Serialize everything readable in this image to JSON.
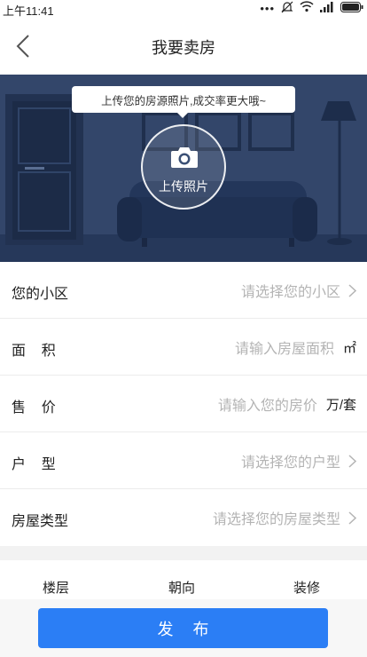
{
  "status_bar": {
    "time": "上午11:41",
    "icons": [
      "dots-icon",
      "mute-bell-icon",
      "wifi-icon",
      "signal-icon",
      "battery-icon"
    ]
  },
  "nav": {
    "title": "我要卖房",
    "back_icon": "chevron-left-icon"
  },
  "hero": {
    "tooltip": "上传您的房源照片,成交率更大哦~",
    "upload_label": "上传照片",
    "upload_icon": "camera-icon"
  },
  "form": {
    "community": {
      "label": "您的小区",
      "placeholder": "请选择您的小区"
    },
    "area": {
      "label": "面    积",
      "placeholder": "请输入房屋面积",
      "unit": "㎡"
    },
    "price": {
      "label": "售    价",
      "placeholder": "请输入您的房价",
      "unit": "万/套"
    },
    "layout": {
      "label": "户    型",
      "placeholder": "请选择您的户型"
    },
    "house_type": {
      "label": "房屋类型",
      "placeholder": "请选择您的房屋类型"
    }
  },
  "tabs": {
    "floor": "楼层",
    "orientation": "朝向",
    "decoration": "装修"
  },
  "actions": {
    "publish_label": "发布"
  },
  "colors": {
    "primary": "#2b7ef5",
    "placeholder": "#b4b4b4",
    "hero_tint": "#2f4260"
  }
}
